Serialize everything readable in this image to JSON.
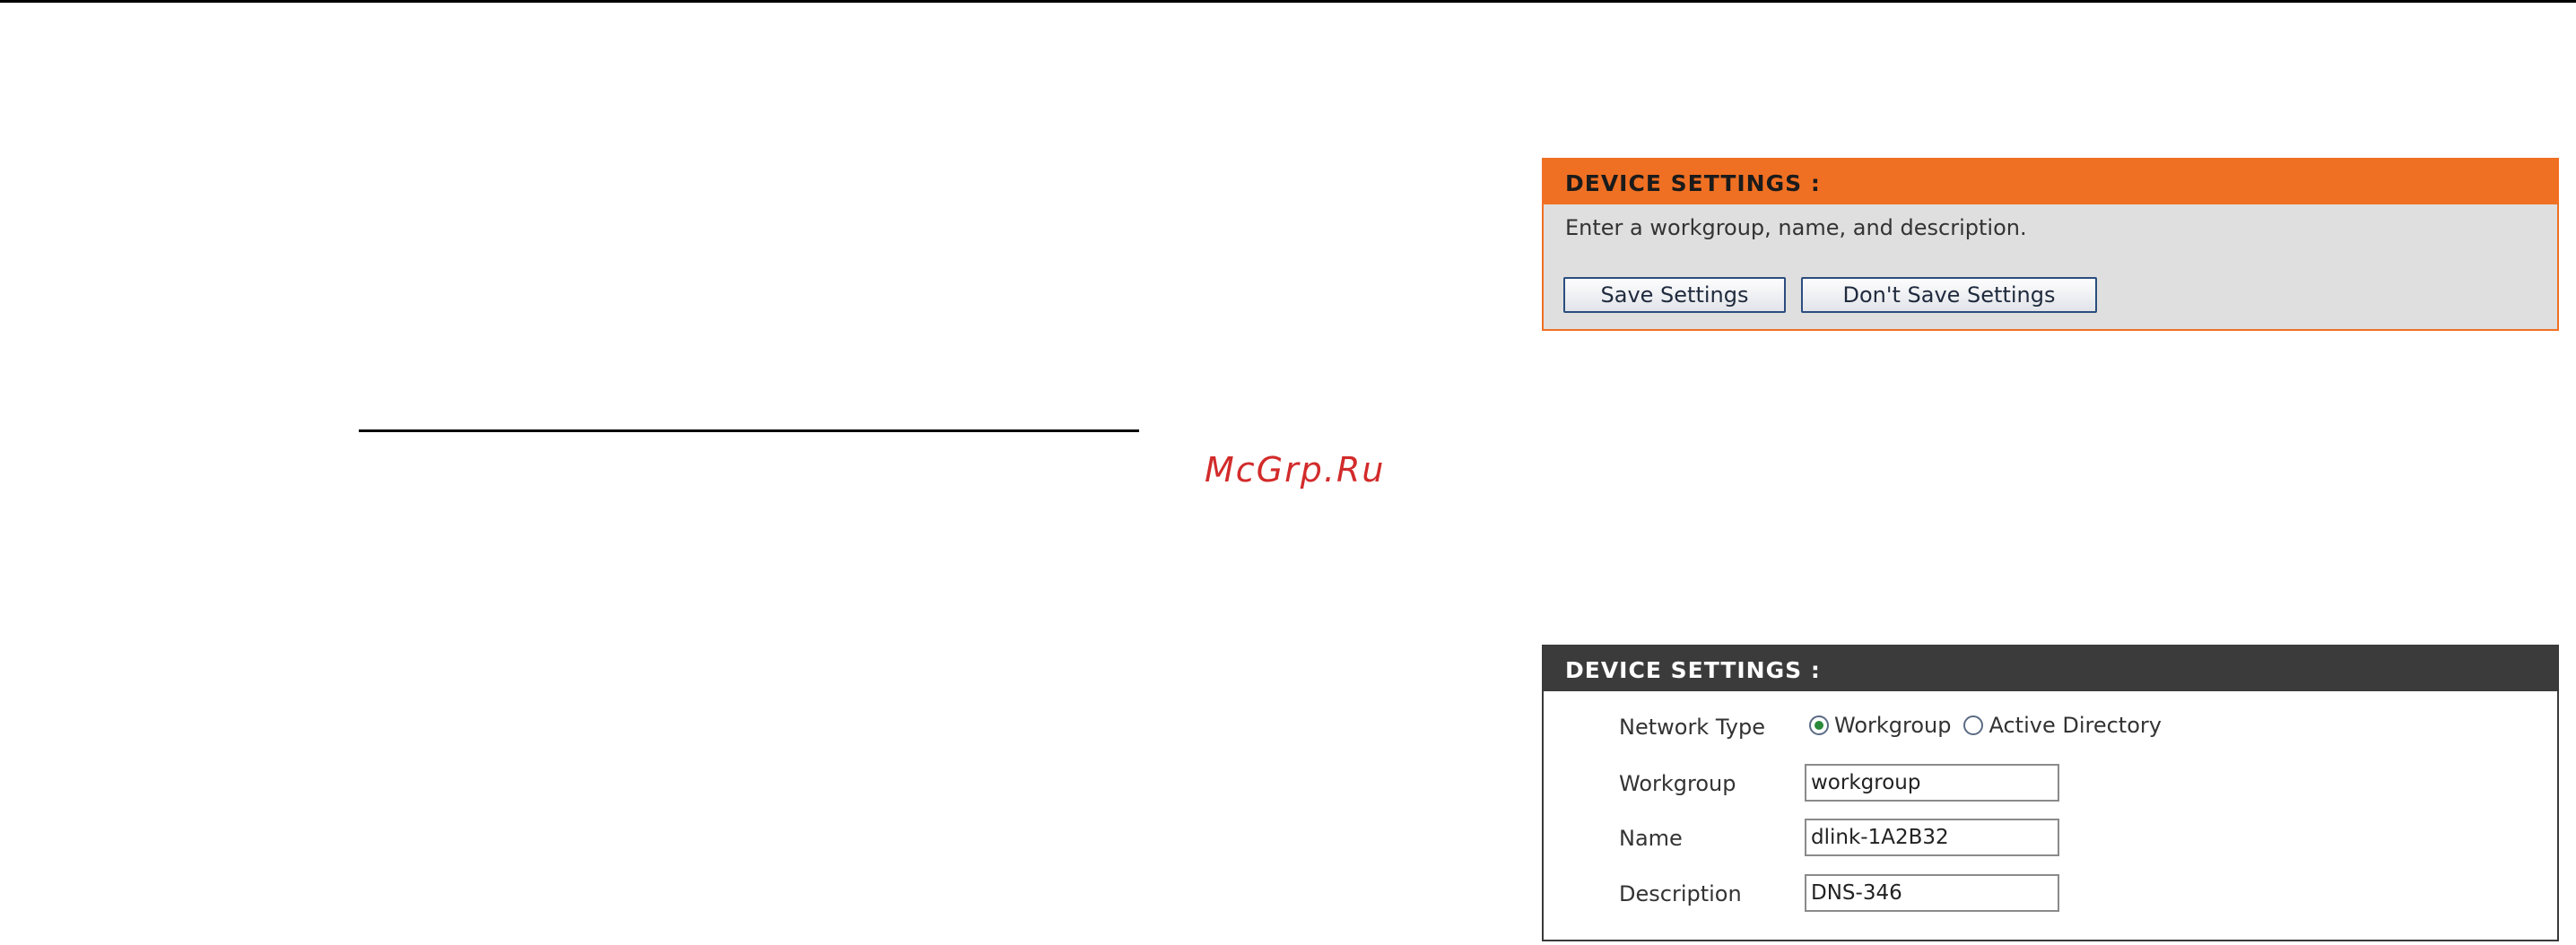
{
  "watermark": "McGrp.Ru",
  "save_panel": {
    "header": "DEVICE SETTINGS :",
    "description": "Enter a workgroup, name, and description.",
    "save_label": "Save Settings",
    "dont_save_label": "Don't Save Settings",
    "header_color": "#f07023"
  },
  "settings_panel": {
    "header": "DEVICE SETTINGS :",
    "header_color": "#3b3b3b",
    "network_type": {
      "label": "Network Type",
      "options": [
        {
          "label": "Workgroup",
          "selected": true
        },
        {
          "label": "Active Directory",
          "selected": false
        }
      ]
    },
    "workgroup": {
      "label": "Workgroup",
      "value": "workgroup"
    },
    "name": {
      "label": "Name",
      "value": "dlink-1A2B32"
    },
    "description": {
      "label": "Description",
      "value": "DNS-346"
    }
  }
}
